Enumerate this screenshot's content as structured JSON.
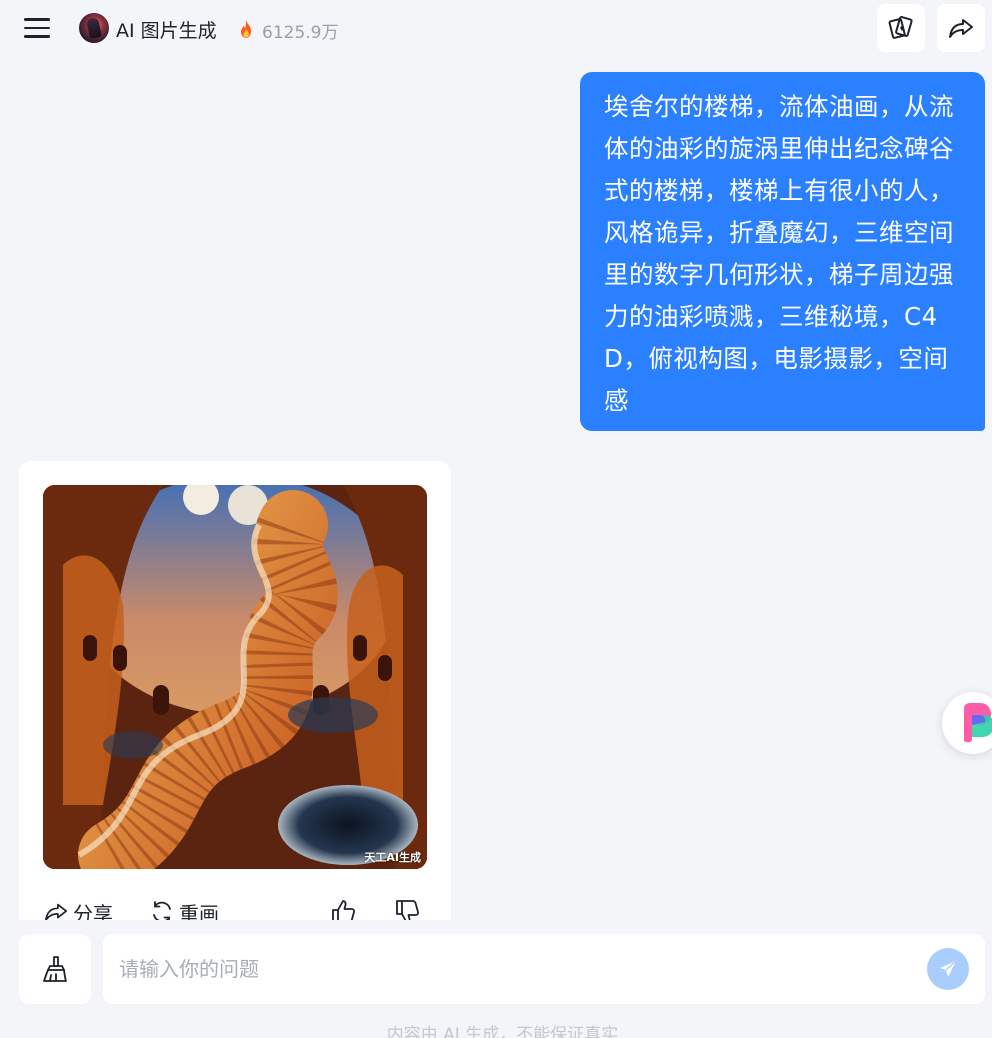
{
  "header": {
    "app_title": "AI 图片生成",
    "heat_count": "6125.9万",
    "icons": {
      "menu": "menu-icon",
      "avatar": "avatar",
      "fire": "fire-icon",
      "cards": "playing-cards-icon",
      "share": "share-icon"
    }
  },
  "conversation": {
    "user_prompt": "埃舍尔的楼梯，流体油画，从流体的油彩的旋涡里伸出纪念碑谷式的楼梯，楼梯上有很小的人，风格诡异，折叠魔幻，三维空间里的数字几何形状，梯子周边强力的油彩喷溅，三维秘境，C4D，俯视构图，电影摄影，空间感",
    "ai_response": {
      "image_watermark": "天工AI生成",
      "actions": {
        "share_label": "分享",
        "redraw_label": "重画"
      }
    }
  },
  "input": {
    "placeholder": "请输入你的问题",
    "value": ""
  },
  "disclaimer": "内容由 AI 生成，不能保证真实",
  "colors": {
    "accent": "#2b80ff",
    "send_disabled": "#a9cdfd",
    "background": "#f3f5f8"
  }
}
